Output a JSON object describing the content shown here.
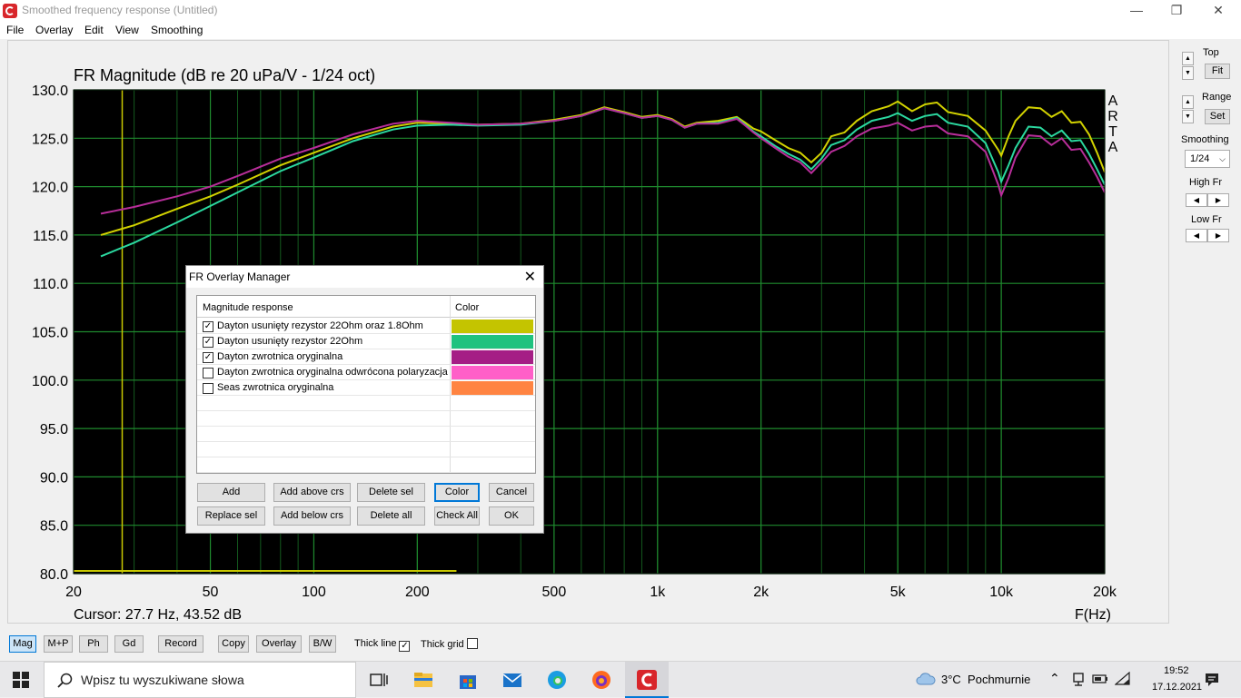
{
  "window": {
    "title": "Smoothed frequency response (Untitled)"
  },
  "menu": [
    "File",
    "Overlay",
    "Edit",
    "View",
    "Smoothing"
  ],
  "plot": {
    "title": "FR Magnitude (dB re 20 uPa/V - 1/24 oct)",
    "cursor_text": "Cursor: 27.7 Hz, 43.52 dB",
    "x_unit_label": "F(Hz)",
    "watermark": [
      "A",
      "R",
      "T",
      "A"
    ],
    "y_ticks": [
      "130.0",
      "125.0",
      "120.0",
      "115.0",
      "110.0",
      "105.0",
      "100.0",
      "95.0",
      "90.0",
      "85.0",
      "80.0"
    ],
    "x_ticks": [
      "20",
      "50",
      "100",
      "200",
      "500",
      "1k",
      "2k",
      "5k",
      "10k",
      "20k"
    ],
    "cursor_hz": 27.7,
    "colors": {
      "background": "#000000",
      "grid": "#1f8a2e",
      "cursor": "#c8c800"
    }
  },
  "chart_data": {
    "type": "line",
    "xscale": "log",
    "xlim": [
      20,
      20000
    ],
    "ylim": [
      80,
      130
    ],
    "series": [
      {
        "name": "Dayton usunięty rezystor 22Ohm oraz 1.8Ohm",
        "color": "#d2d200",
        "x": [
          24,
          30,
          40,
          50,
          60,
          80,
          100,
          130,
          170,
          200,
          250,
          300,
          400,
          500,
          600,
          700,
          800,
          900,
          1000,
          1100,
          1200,
          1300,
          1500,
          1700,
          1800,
          1900,
          2000,
          2200,
          2400,
          2600,
          2800,
          3000,
          3200,
          3500,
          3800,
          4200,
          4700,
          5000,
          5500,
          6000,
          6500,
          7000,
          8000,
          9000,
          9800,
          10000,
          10500,
          11000,
          12000,
          13000,
          14000,
          15000,
          16000,
          17000,
          18000,
          19000,
          20000
        ],
        "y": [
          115,
          116,
          117.7,
          119,
          120.2,
          122.2,
          123.5,
          125,
          126.2,
          126.6,
          126.5,
          126.4,
          126.5,
          126.9,
          127.4,
          128.2,
          127.7,
          127.2,
          127.4,
          127,
          126.2,
          126.6,
          126.8,
          127.2,
          126.6,
          126,
          125.7,
          124.8,
          124,
          123.5,
          122.5,
          123.5,
          125.2,
          125.6,
          126.8,
          127.8,
          128.3,
          128.8,
          127.8,
          128.5,
          128.7,
          127.7,
          127.3,
          125.8,
          123.8,
          123.2,
          125.2,
          126.8,
          128.2,
          128.1,
          127.2,
          127.8,
          126.6,
          126.7,
          125.4,
          123.5,
          121.5
        ]
      },
      {
        "name": "Dayton usunięty rezystor 22Ohm",
        "color": "#2bd9a0",
        "x": [
          24,
          30,
          40,
          50,
          60,
          80,
          100,
          130,
          170,
          200,
          250,
          300,
          400,
          500,
          600,
          700,
          800,
          900,
          1000,
          1100,
          1200,
          1300,
          1500,
          1700,
          1800,
          1900,
          2000,
          2200,
          2400,
          2600,
          2800,
          3000,
          3200,
          3500,
          3800,
          4200,
          4700,
          5000,
          5500,
          6000,
          6500,
          7000,
          8000,
          9000,
          9800,
          10000,
          10500,
          11000,
          12000,
          13000,
          14000,
          15000,
          16000,
          17000,
          18000,
          19000,
          20000
        ],
        "y": [
          112.8,
          114.2,
          116.3,
          118,
          119.4,
          121.6,
          123,
          124.7,
          125.9,
          126.3,
          126.4,
          126.3,
          126.4,
          126.8,
          127.3,
          128.1,
          127.6,
          127.1,
          127.3,
          126.9,
          126.1,
          126.5,
          126.6,
          127.1,
          126.4,
          125.7,
          125.2,
          124.2,
          123.4,
          122.8,
          121.8,
          122.9,
          124.3,
          124.8,
          125.9,
          126.8,
          127.2,
          127.6,
          126.8,
          127.3,
          127.5,
          126.6,
          126.2,
          124.5,
          121.5,
          120.5,
          122.2,
          124,
          126.2,
          126.1,
          125.2,
          125.8,
          124.7,
          124.8,
          123.4,
          121.8,
          120.2
        ]
      },
      {
        "name": "Dayton zwrotnica oryginalna",
        "color": "#b82e9a",
        "x": [
          24,
          30,
          40,
          50,
          60,
          80,
          100,
          130,
          170,
          200,
          250,
          300,
          400,
          500,
          600,
          700,
          800,
          900,
          1000,
          1100,
          1200,
          1300,
          1500,
          1700,
          1800,
          1900,
          2000,
          2200,
          2400,
          2600,
          2800,
          3000,
          3200,
          3500,
          3800,
          4200,
          4700,
          5000,
          5500,
          6000,
          6500,
          7000,
          8000,
          9000,
          9800,
          10000,
          10500,
          11000,
          12000,
          13000,
          14000,
          15000,
          16000,
          17000,
          18000,
          19000,
          20000
        ],
        "y": [
          117.2,
          117.9,
          119,
          120,
          121.1,
          122.9,
          124,
          125.4,
          126.5,
          126.8,
          126.6,
          126.4,
          126.5,
          126.8,
          127.3,
          128.1,
          127.6,
          127.1,
          127.3,
          126.9,
          126.1,
          126.5,
          126.5,
          127,
          126.3,
          125.6,
          125,
          124,
          123.1,
          122.5,
          121.4,
          122.5,
          123.6,
          124.2,
          125.2,
          126,
          126.3,
          126.6,
          125.8,
          126.2,
          126.3,
          125.5,
          125.2,
          123.6,
          120.2,
          119.1,
          120.9,
          123,
          125.3,
          125.2,
          124.3,
          125,
          123.8,
          123.9,
          122.5,
          121,
          119.4
        ]
      }
    ]
  },
  "side_panel": {
    "top_label": "Top",
    "fit_button": "Fit",
    "range_label": "Range",
    "set_button": "Set",
    "smoothing_label": "Smoothing",
    "smoothing_value": "1/24",
    "high_fr_label": "High Fr",
    "low_fr_label": "Low Fr"
  },
  "dialog": {
    "title": "FR Overlay Manager",
    "col_response": "Magnitude response",
    "col_color": "Color",
    "rows": [
      {
        "label": "Dayton usunięty rezystor 22Ohm oraz 1.8Ohm",
        "checked": "✓",
        "color": "#c4c400"
      },
      {
        "label": "Dayton usunięty rezystor 22Ohm",
        "checked": "✓",
        "color": "#1fc27f"
      },
      {
        "label": "Dayton zwrotnica oryginalna",
        "checked": "✓",
        "color": "#a51e85"
      },
      {
        "label": "Dayton zwrotnica oryginalna odwrócona polaryzacja",
        "checked": "",
        "color": "#ff5fc8"
      },
      {
        "label": "Seas zwrotnica oryginalna",
        "checked": "",
        "color": "#ff8442"
      }
    ],
    "buttons": {
      "add": "Add",
      "add_above": "Add above crs",
      "delete_sel": "Delete sel",
      "color": "Color",
      "cancel": "Cancel",
      "replace_sel": "Replace sel",
      "add_below": "Add below crs",
      "delete_all": "Delete all",
      "check_all": "Check All",
      "ok": "OK"
    }
  },
  "toolbar": {
    "mag": "Mag",
    "mp": "M+P",
    "ph": "Ph",
    "gd": "Gd",
    "record": "Record",
    "copy": "Copy",
    "overlay": "Overlay",
    "bw": "B/W",
    "thick_line": "Thick line",
    "thick_line_checked": "✓",
    "thick_grid": "Thick grid",
    "thick_grid_checked": ""
  },
  "taskbar": {
    "search_placeholder": "Wpisz tu wyszukiwane słowa",
    "weather": "3°C  Pochmurnie",
    "time": "19:52",
    "date": "17.12.2021"
  }
}
